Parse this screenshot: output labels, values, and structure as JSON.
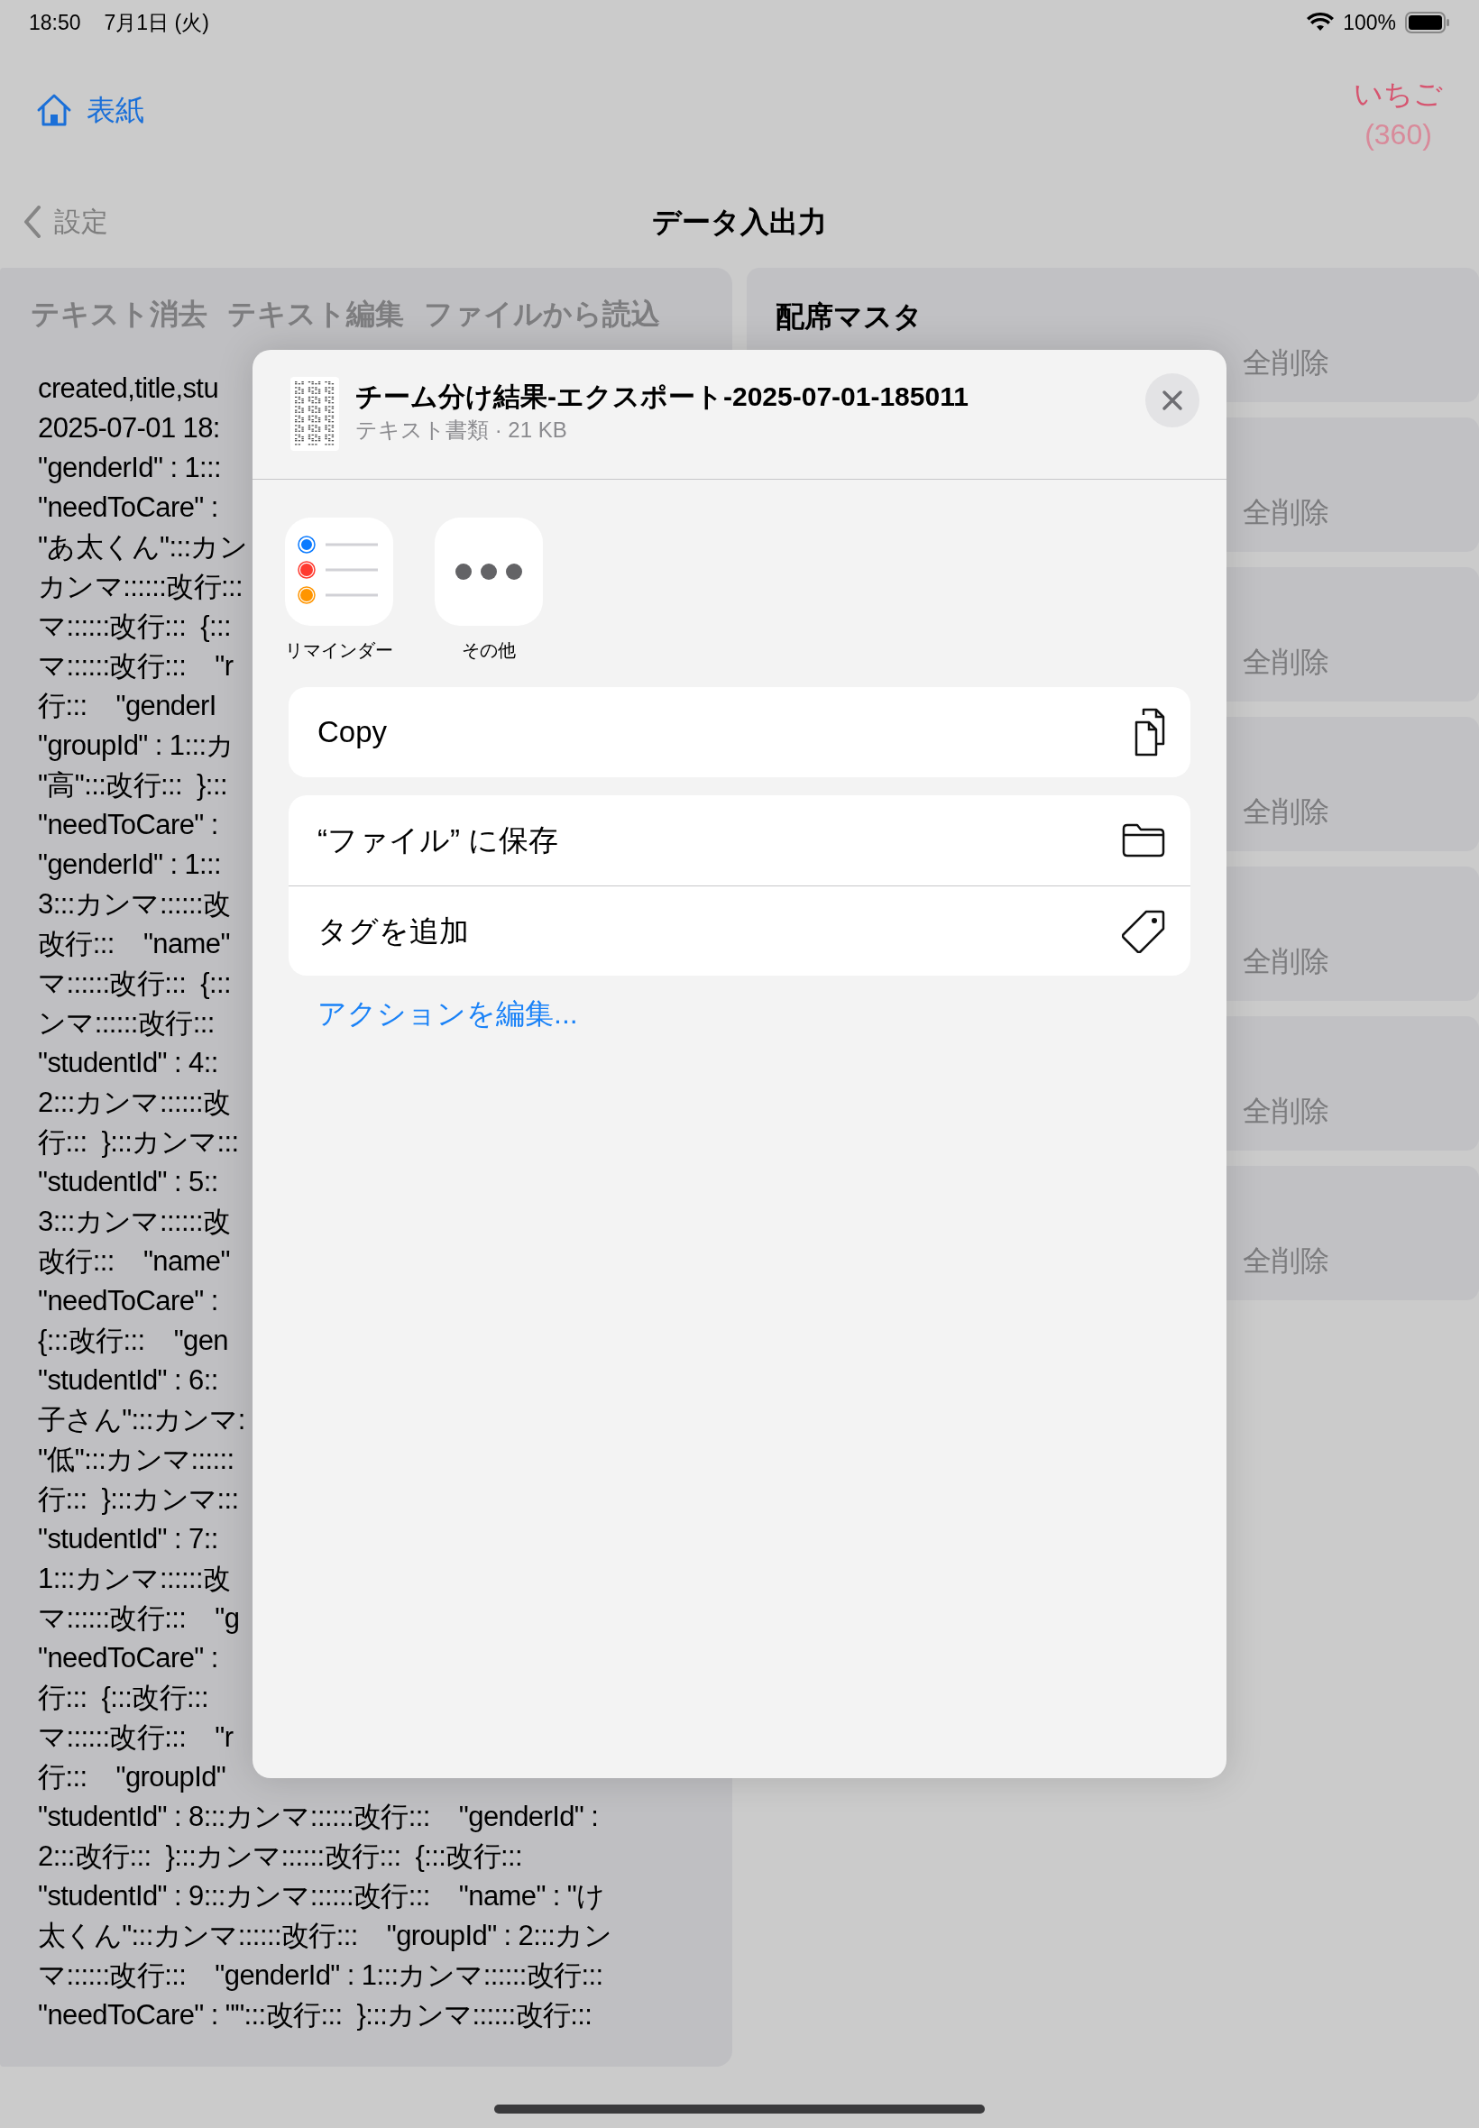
{
  "status_bar": {
    "time": "18:50",
    "date": "7月1日 (火)",
    "battery": "100%"
  },
  "nav": {
    "home_link": "表紙",
    "user_name": "いちご",
    "user_count": "(360)",
    "back": "設定",
    "title": "データ入出力"
  },
  "left_panel": {
    "toolbar": [
      "テキスト消去",
      "テキスト編集",
      "ファイルから読込"
    ],
    "text_lines": [
      "created,title,stu",
      "2025-07-01 18:",
      "\"genderId\" : 1:::",
      "\"needToCare\" :",
      "\"あ太くん\":::カン",
      "カンマ::::::改行:::",
      "マ::::::改行:::  {:::",
      "マ::::::改行:::    \"r",
      "行:::    \"genderI",
      "\"groupId\" : 1:::カ",
      "\"高\":::改行:::  }:::",
      "\"needToCare\" :",
      "\"genderId\" : 1:::",
      "3:::カンマ::::::改",
      "改行:::    \"name\"",
      "マ::::::改行:::  {:::",
      "ンマ::::::改行:::",
      "\"studentId\" : 4::",
      "2:::カンマ::::::改",
      "行:::  }:::カンマ:::",
      "\"studentId\" : 5::",
      "3:::カンマ::::::改",
      "改行:::    \"name\"",
      "\"needToCare\" :",
      "{:::改行:::    \"gen",
      "\"studentId\" : 6::",
      "子さん\":::カンマ:",
      "\"低\":::カンマ::::::",
      "行:::  }:::カンマ:::",
      "\"studentId\" : 7::",
      "1:::カンマ::::::改",
      "マ::::::改行:::    \"g",
      "\"needToCare\" :",
      "行:::  {:::改行:::",
      "マ::::::改行:::    \"r",
      "行:::    \"groupId\"",
      "\"studentId\" : 8:::カンマ::::::改行:::    \"genderId\" :",
      "2:::改行:::  }:::カンマ::::::改行:::  {:::改行:::",
      "\"studentId\" : 9:::カンマ::::::改行:::    \"name\" : \"け",
      "太くん\":::カンマ::::::改行:::    \"groupId\" : 2:::カン",
      "マ::::::改行:::    \"genderId\" : 1:::カンマ::::::改行:::",
      "\"needToCare\" : \"\":::改行:::  }:::カンマ::::::改行:::"
    ]
  },
  "right_panel": {
    "title": "配席マスタ",
    "cards": [
      {
        "action": "全削除"
      },
      {
        "action": "全削除"
      },
      {
        "action": "全削除"
      },
      {
        "action": "全削除"
      },
      {
        "action": "全削除"
      },
      {
        "action": "全削除"
      },
      {
        "action": "全削除"
      }
    ]
  },
  "share_sheet": {
    "file_name": "チーム分け結果-エクスポート-2025-07-01-185011",
    "file_info": "テキスト書類 · 21 KB",
    "apps": [
      {
        "label": "リマインダー",
        "kind": "reminders"
      },
      {
        "label": "その他",
        "kind": "more"
      }
    ],
    "action_groups": [
      [
        {
          "label": "Copy",
          "kind": "copy"
        }
      ],
      [
        {
          "label": "“ファイル” に保存",
          "kind": "folder"
        },
        {
          "label": "タグを追加",
          "kind": "tag"
        }
      ]
    ],
    "edit_link": "アクションを編集..."
  }
}
